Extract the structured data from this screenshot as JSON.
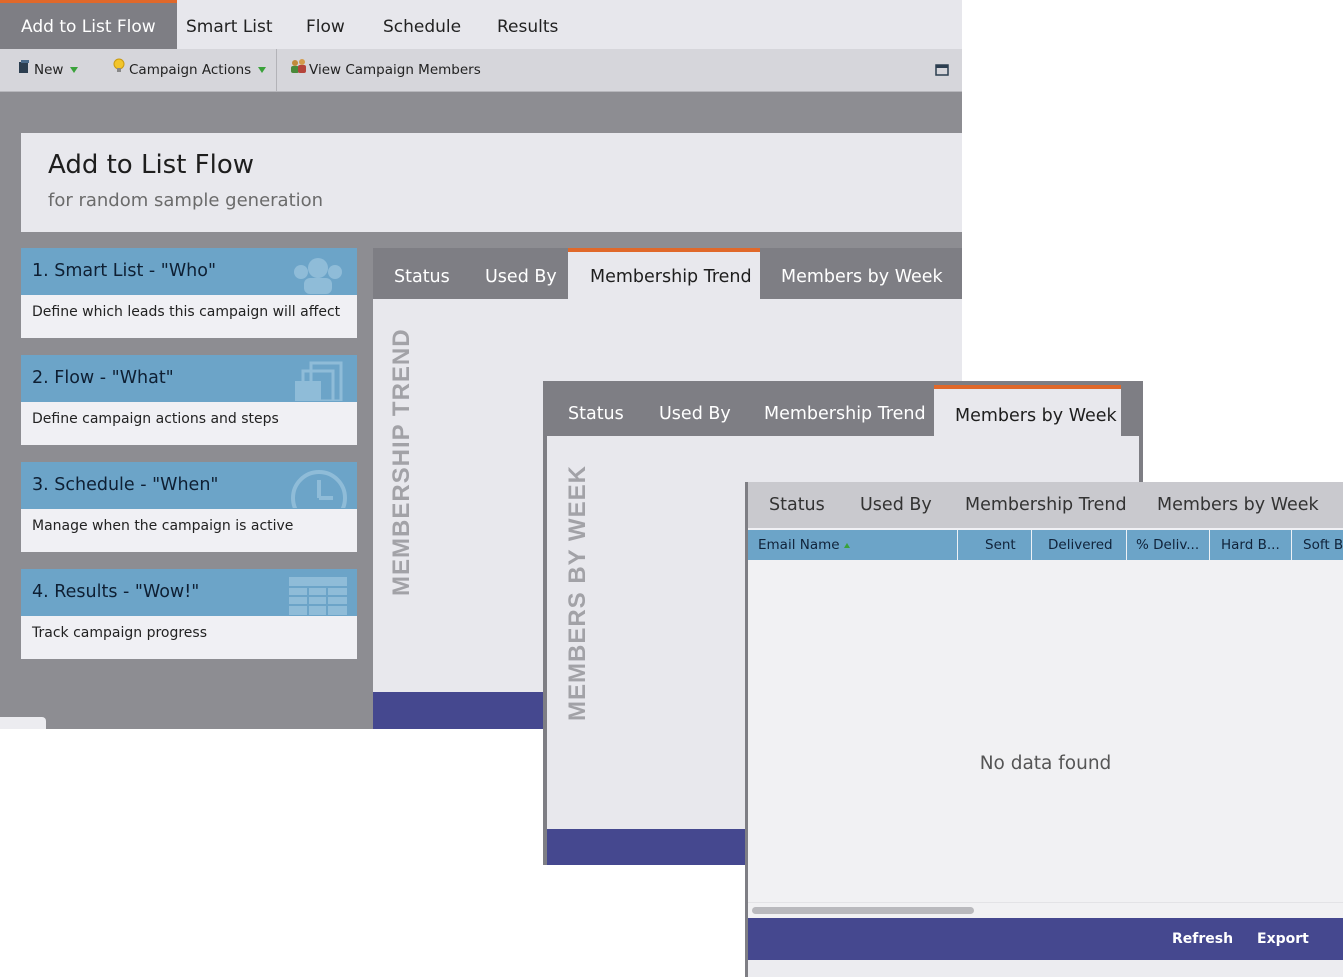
{
  "top_tabs": [
    "Add to List Flow",
    "Smart List",
    "Flow",
    "Schedule",
    "Results"
  ],
  "toolbar": {
    "new_label": "New",
    "campaign_actions_label": "Campaign Actions",
    "view_members_label": "View Campaign Members",
    "icons": [
      "new-icon",
      "lightbulb-icon",
      "people-icon",
      "window-icon"
    ]
  },
  "header": {
    "title": "Add to List Flow",
    "subtitle": "for random sample generation"
  },
  "steps": [
    {
      "title": "1. Smart List - \"Who\"",
      "desc": "Define which leads this campaign will affect",
      "icon": "people-icon"
    },
    {
      "title": "2. Flow - \"What\"",
      "desc": "Define campaign actions and steps",
      "icon": "stacked-pages-icon"
    },
    {
      "title": "3. Schedule - \"When\"",
      "desc": "Manage when the campaign is active",
      "icon": "clock-icon"
    },
    {
      "title": "4. Results - \"Wow!\"",
      "desc": "Track campaign progress",
      "icon": "table-icon"
    }
  ],
  "panel_tabs": [
    "Status",
    "Used By",
    "Membership Trend",
    "Members by Week"
  ],
  "panel_main": {
    "active_tab": "Membership Trend",
    "vertical_label": "MEMBERSHIP TREND"
  },
  "panel_week": {
    "active_tab": "Members by Week",
    "vertical_label": "MEMBERS BY WEEK"
  },
  "grid": {
    "columns": [
      "Email Name",
      "Sent",
      "Delivered",
      "% Deliv...",
      "Hard B...",
      "Soft Bo"
    ],
    "empty_text": "No data found",
    "footer_buttons": [
      "Refresh",
      "Export"
    ]
  },
  "colors": {
    "accent_orange": "#e0682a",
    "step_blue": "#6ca4c8",
    "footer_indigo": "#45488f",
    "toolbar_gray": "#d6d6db"
  }
}
